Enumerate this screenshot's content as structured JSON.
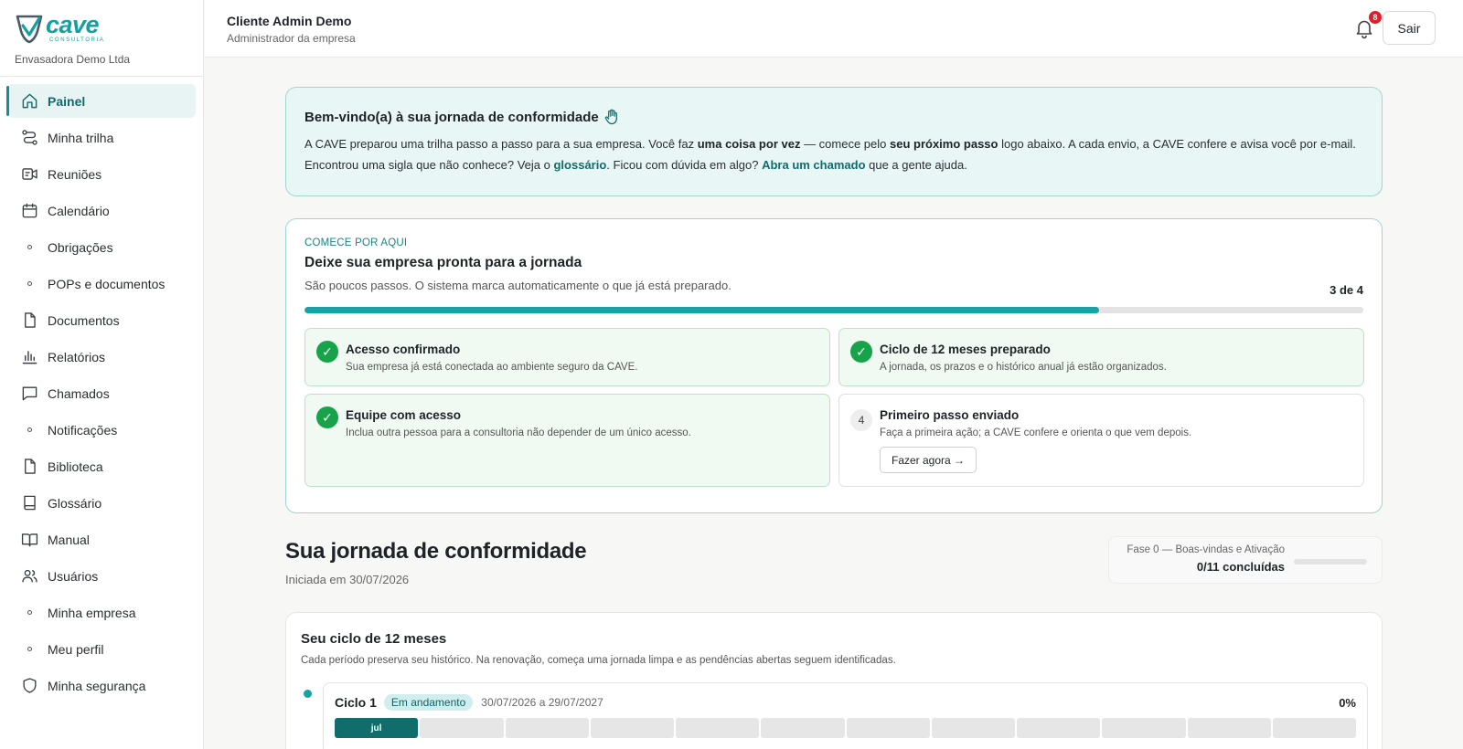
{
  "brand": {
    "logo_word": "cave",
    "logo_sub": "CONSULTORIA",
    "company": "Envasadora Demo Ltda",
    "color": "#14a0a0"
  },
  "sidebar": {
    "items": [
      {
        "label": "Painel",
        "icon": "home-icon",
        "active": true
      },
      {
        "label": "Minha trilha",
        "icon": "route-icon"
      },
      {
        "label": "Reuniões",
        "icon": "video-icon"
      },
      {
        "label": "Calendário",
        "icon": "calendar-icon"
      },
      {
        "label": "Obrigações",
        "icon": "dot-icon"
      },
      {
        "label": "POPs e documentos",
        "icon": "dot-icon"
      },
      {
        "label": "Documentos",
        "icon": "file-icon"
      },
      {
        "label": "Relatórios",
        "icon": "bar-chart-icon"
      },
      {
        "label": "Chamados",
        "icon": "message-icon"
      },
      {
        "label": "Notificações",
        "icon": "dot-icon"
      },
      {
        "label": "Biblioteca",
        "icon": "file-icon"
      },
      {
        "label": "Glossário",
        "icon": "book-icon"
      },
      {
        "label": "Manual",
        "icon": "open-book-icon"
      },
      {
        "label": "Usuários",
        "icon": "users-icon"
      },
      {
        "label": "Minha empresa",
        "icon": "dot-icon"
      },
      {
        "label": "Meu perfil",
        "icon": "dot-icon"
      },
      {
        "label": "Minha segurança",
        "icon": "shield-icon"
      }
    ]
  },
  "header": {
    "user_name": "Cliente Admin Demo",
    "user_role": "Administrador da empresa",
    "notification_count": "8",
    "logout_label": "Sair"
  },
  "welcome": {
    "title": "Bem-vindo(a) à sua jornada de conformidade",
    "t1": "A CAVE preparou uma trilha passo a passo para a sua empresa. Você faz ",
    "b1": "uma coisa por vez",
    "t2": " — comece pelo ",
    "b2": "seu próximo passo",
    "t3": " logo abaixo. A cada envio, a CAVE confere e avisa você por e-mail. Encontrou uma sigla que não conhece? Veja o ",
    "link1": "glossário",
    "t4": ". Ficou com dúvida em algo? ",
    "link2": "Abra um chamado",
    "t5": " que a gente ajuda."
  },
  "start": {
    "eyebrow": "COMECE POR AQUI",
    "title": "Deixe sua empresa pronta para a jornada",
    "subtitle": "São poucos passos. O sistema marca automaticamente o que já está preparado.",
    "counter": "3 de 4",
    "progress": 0.75,
    "steps": [
      {
        "title": "Acesso confirmado",
        "desc": "Sua empresa já está conectada ao ambiente seguro da CAVE.",
        "done": true
      },
      {
        "title": "Ciclo de 12 meses preparado",
        "desc": "A jornada, os prazos e o histórico anual já estão organizados.",
        "done": true
      },
      {
        "title": "Equipe com acesso",
        "desc": "Inclua outra pessoa para a consultoria não depender de um único acesso.",
        "done": true
      },
      {
        "title": "Primeiro passo enviado",
        "desc": "Faça a primeira ação; a CAVE confere e orienta o que vem depois.",
        "done": false,
        "number": "4",
        "action": "Fazer agora →"
      }
    ]
  },
  "journey": {
    "title": "Sua jornada de conformidade",
    "started": "Iniciada em 30/07/2026",
    "phase_label": "Fase 0 — Boas-vindas e Ativação",
    "phase_count": "0/11 concluídas",
    "phase_progress": 0
  },
  "cycle": {
    "title": "Seu ciclo de 12 meses",
    "subtitle": "Cada período preserva seu histórico. Na renovação, começa uma jornada limpa e as pendências abertas seguem identificadas.",
    "name": "Ciclo 1",
    "status": "Em andamento",
    "dates": "30/07/2026 a 29/07/2027",
    "percent": "0%",
    "current_month": "jul",
    "month_count": 12
  }
}
